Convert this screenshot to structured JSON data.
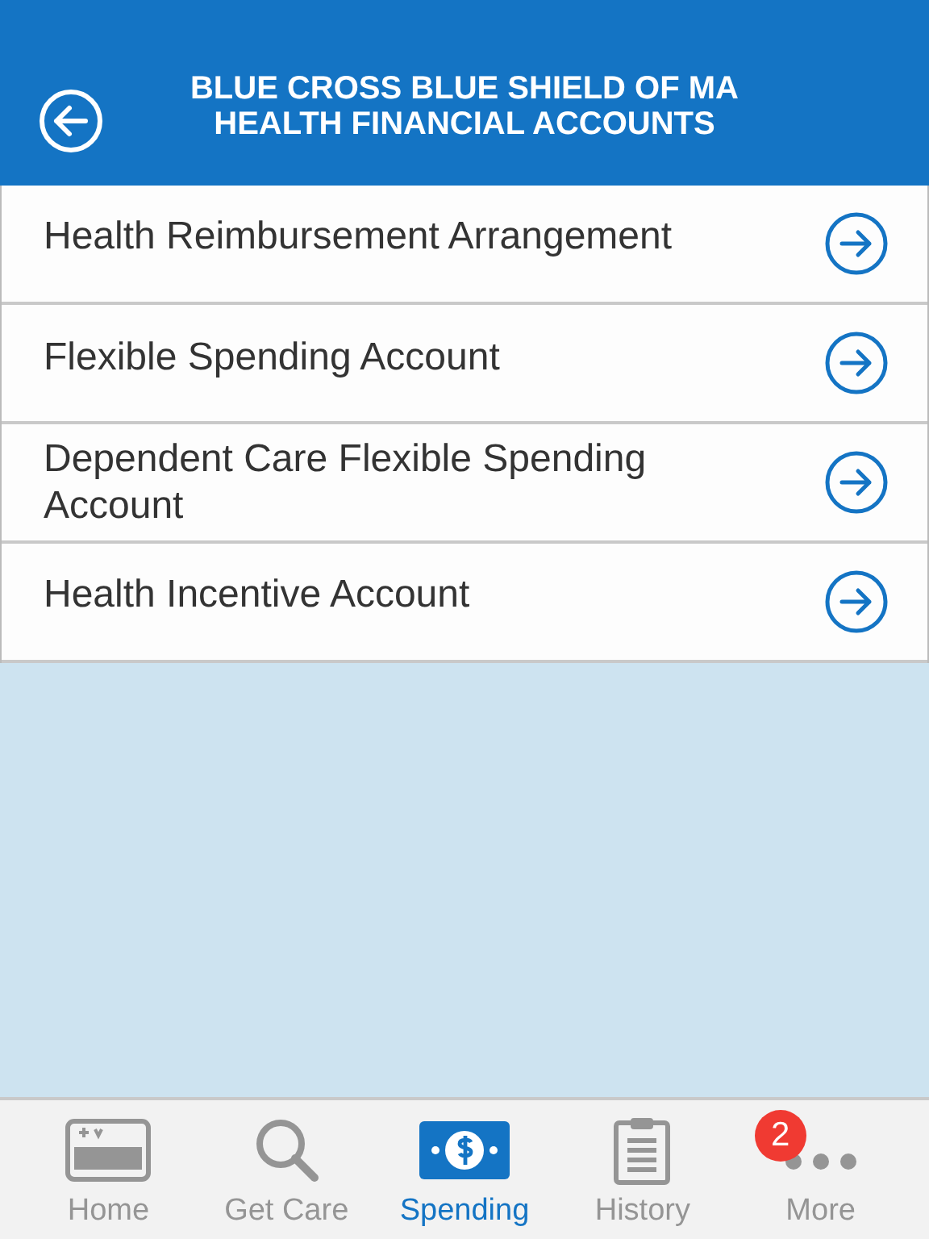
{
  "header": {
    "title_lines": [
      "BLUE CROSS BLUE SHIELD OF MA",
      "HEALTH FINANCIAL ACCOUNTS"
    ]
  },
  "accounts": [
    {
      "label": "Health Reimbursement Arrangement"
    },
    {
      "label": "Flexible Spending Account"
    },
    {
      "label": "Dependent Care Flexible Spending Account"
    },
    {
      "label": "Health Incentive Account"
    }
  ],
  "tab_bar": [
    {
      "kind": "home",
      "label": "Home",
      "selected": false
    },
    {
      "kind": "search",
      "label": "Get Care",
      "selected": false
    },
    {
      "kind": "money",
      "label": "Spending",
      "selected": true
    },
    {
      "kind": "clipboard",
      "label": "History",
      "selected": false
    },
    {
      "kind": "more",
      "label": "More",
      "selected": false,
      "badge": "2"
    }
  ]
}
